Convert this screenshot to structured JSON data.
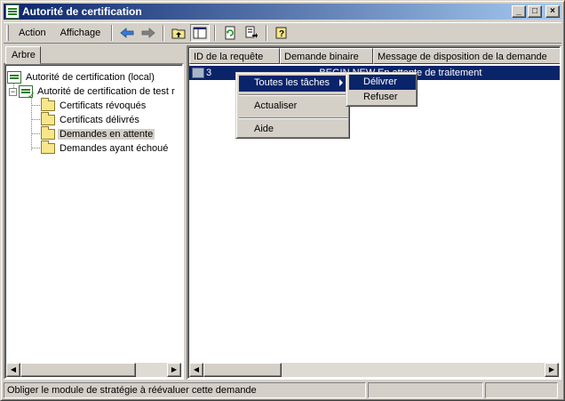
{
  "window": {
    "title": "Autorité de certification",
    "minimize": "_",
    "maximize": "□",
    "close": "×"
  },
  "menubar": {
    "action": "Action",
    "view": "Affichage"
  },
  "toolbar": {
    "buttons": [
      "back-arrow-icon",
      "forward-arrow-icon",
      "up-folder-icon",
      "show-hide-tree-icon",
      "refresh-icon",
      "export-list-icon",
      "help-icon"
    ]
  },
  "left_pane": {
    "tab_label": "Arbre",
    "tree": {
      "root": "Autorité de certification (local)",
      "ca": "Autorité de certification de test r",
      "expander": "−",
      "folders": [
        "Certificats révoqués",
        "Certificats délivrés",
        "Demandes en attente",
        "Demandes ayant échoué"
      ],
      "selected_folder": "Demandes en attente"
    }
  },
  "list": {
    "columns": [
      "ID de la requête",
      "Demande binaire",
      "Message de disposition de la demande"
    ],
    "rows": [
      {
        "id": "3",
        "binary": "-----BEGIN NEW...",
        "disposition": "En attente de traitement"
      }
    ]
  },
  "context_menu": {
    "items": [
      "Toutes les tâches",
      "Actualiser",
      "Aide"
    ]
  },
  "submenu": {
    "items": [
      "Délivrer",
      "Refuser"
    ]
  },
  "status_bar": {
    "message": "Obliger le module de stratégie à réévaluer cette demande"
  }
}
